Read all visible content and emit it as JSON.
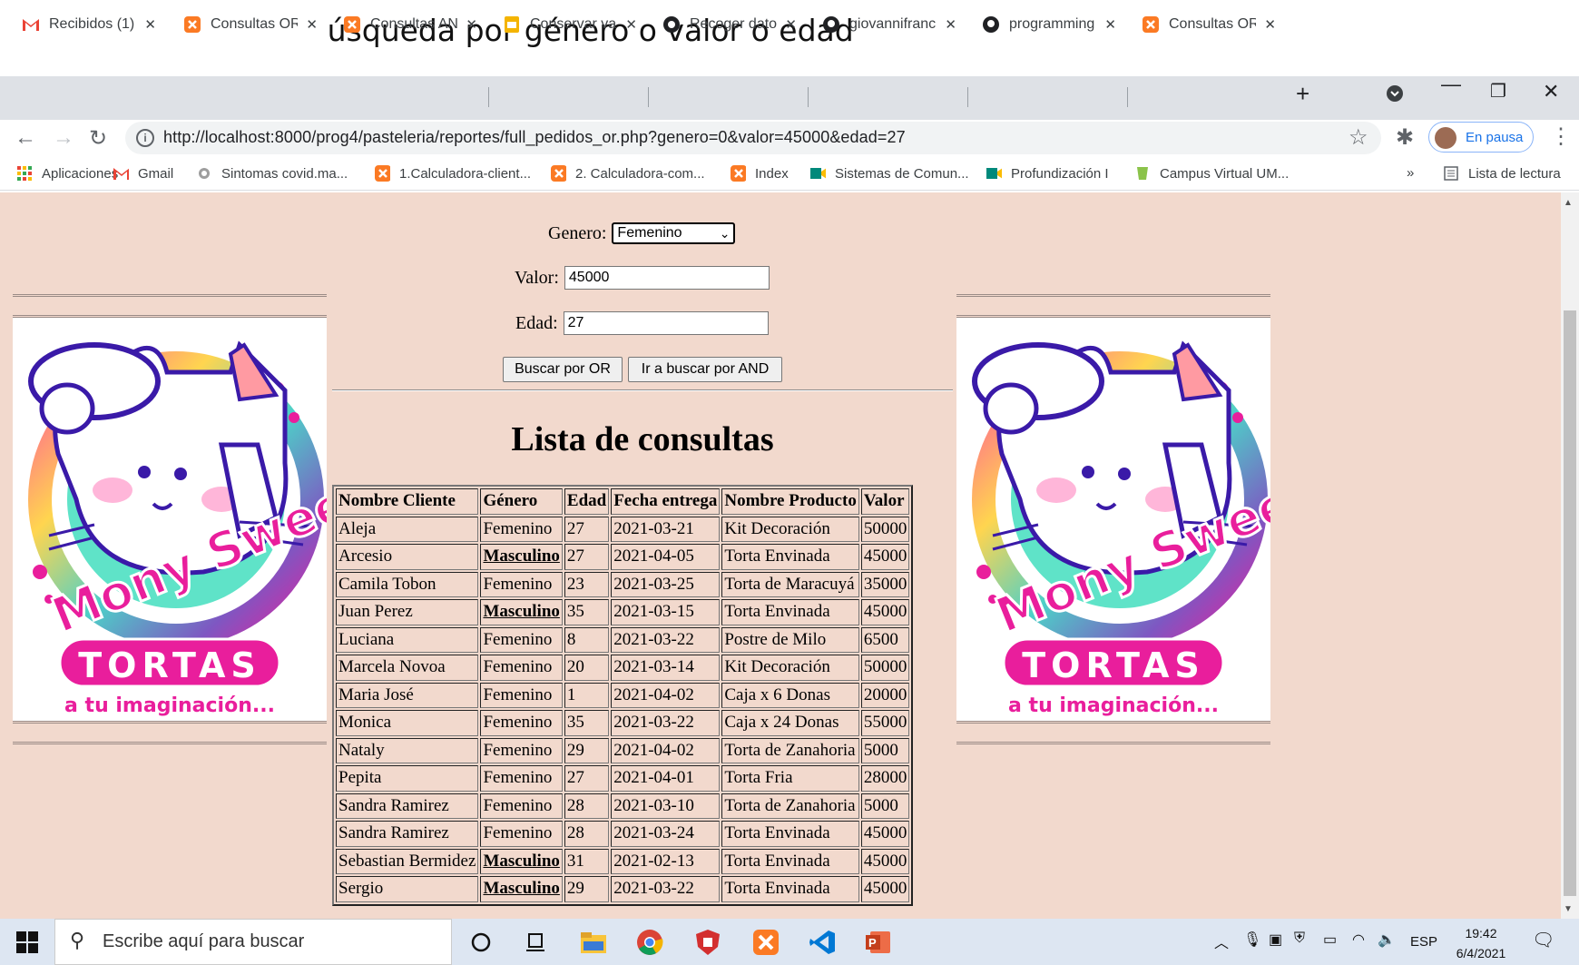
{
  "caption": "Búsqueda por género o valor o edad",
  "tabs": [
    {
      "title": "Recibidos (1) -",
      "icon": "gmail-icon"
    },
    {
      "title": "Consultas OR",
      "icon": "xampp-icon"
    },
    {
      "title": "Consultas AND",
      "icon": "xampp-icon"
    },
    {
      "title": "Conservar valo",
      "icon": "slides-icon"
    },
    {
      "title": "Recoger dato",
      "icon": "edge-icon"
    },
    {
      "title": "giovannifranc",
      "icon": "github-icon"
    },
    {
      "title": "programming",
      "icon": "github-icon"
    },
    {
      "title": "Consultas OR",
      "icon": "xampp-icon"
    }
  ],
  "address": {
    "url": "http://localhost:8000/prog4/pasteleria/reportes/full_pedidos_or.php?genero=0&valor=45000&edad=27"
  },
  "profile": {
    "label": "En pausa"
  },
  "bookmarks": [
    {
      "label": "Aplicaciones"
    },
    {
      "label": "Gmail"
    },
    {
      "label": "Sintomas covid.ma..."
    },
    {
      "label": "1.Calculadora-client..."
    },
    {
      "label": "2. Calculadora-com..."
    },
    {
      "label": "Index"
    },
    {
      "label": "Sistemas de Comun..."
    },
    {
      "label": "Profundización I"
    },
    {
      "label": "Campus Virtual UM..."
    }
  ],
  "reading_list": "Lista de lectura",
  "form": {
    "genero_label": "Genero:",
    "genero_value": "Femenino",
    "valor_label": "Valor:",
    "valor_value": "45000",
    "edad_label": "Edad:",
    "edad_value": "27",
    "btn_or": "Buscar por OR",
    "btn_and": "Ir a buscar por AND"
  },
  "heading": "Lista de consultas",
  "table": {
    "headers": [
      "Nombre Cliente",
      "Género",
      "Edad",
      "Fecha entrega",
      "Nombre Producto",
      "Valor"
    ],
    "rows": [
      [
        "Aleja",
        "Femenino",
        "27",
        "2021-03-21",
        "Kit Decoración",
        "50000"
      ],
      [
        "Arcesio",
        "Masculino",
        "27",
        "2021-04-05",
        "Torta Envinada",
        "45000"
      ],
      [
        "Camila Tobon",
        "Femenino",
        "23",
        "2021-03-25",
        "Torta de Maracuyá",
        "35000"
      ],
      [
        "Juan Perez",
        "Masculino",
        "35",
        "2021-03-15",
        "Torta Envinada",
        "45000"
      ],
      [
        "Luciana",
        "Femenino",
        "8",
        "2021-03-22",
        "Postre de Milo",
        "6500"
      ],
      [
        "Marcela Novoa",
        "Femenino",
        "20",
        "2021-03-14",
        "Kit Decoración",
        "50000"
      ],
      [
        "Maria José",
        "Femenino",
        "1",
        "2021-04-02",
        "Caja x 6 Donas",
        "20000"
      ],
      [
        "Monica",
        "Femenino",
        "35",
        "2021-03-22",
        "Caja x 24 Donas",
        "55000"
      ],
      [
        "Nataly",
        "Femenino",
        "29",
        "2021-04-02",
        "Torta de Zanahoria",
        "5000"
      ],
      [
        "Pepita",
        "Femenino",
        "27",
        "2021-04-01",
        "Torta Fria",
        "28000"
      ],
      [
        "Sandra Ramirez",
        "Femenino",
        "28",
        "2021-03-10",
        "Torta de Zanahoria",
        "5000"
      ],
      [
        "Sandra Ramirez",
        "Femenino",
        "28",
        "2021-03-24",
        "Torta Envinada",
        "45000"
      ],
      [
        "Sebastian Bermidez",
        "Masculino",
        "31",
        "2021-02-13",
        "Torta Envinada",
        "45000"
      ],
      [
        "Sergio",
        "Masculino",
        "29",
        "2021-03-22",
        "Torta Envinada",
        "45000"
      ]
    ]
  },
  "logo": {
    "brand": "Mony Sweet",
    "sub": "TORTAS",
    "tagline": "a tu imaginación..."
  },
  "taskbar": {
    "search_placeholder": "Escribe aquí para buscar",
    "lang": "ESP",
    "time": "19:42",
    "date": "6/4/2021"
  },
  "colors": {
    "page_bg": "#f2d9cd",
    "logo_pink": "#e91e9c",
    "taskbar": "#dde6f2"
  }
}
